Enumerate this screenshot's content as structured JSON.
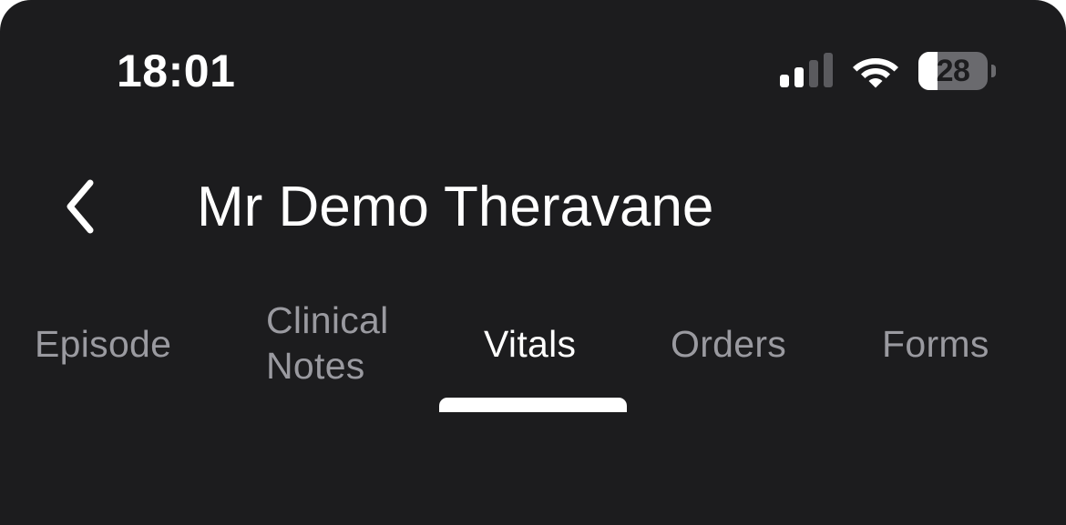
{
  "status_bar": {
    "time": "18:01",
    "signal_bars_active": 2,
    "signal_bars_total": 4,
    "wifi_icon": "wifi-icon",
    "battery_level_text": "28",
    "battery_fraction": 0.28
  },
  "header": {
    "back_icon": "chevron-left-icon",
    "title": "Mr Demo Theravane"
  },
  "tabs": [
    {
      "label": "Episode",
      "active": false
    },
    {
      "label_line1": "Clinical",
      "label_line2": "Notes",
      "active": false
    },
    {
      "label": "Vitals",
      "active": true
    },
    {
      "label": "Orders",
      "active": false
    },
    {
      "label": "Forms",
      "active": false
    }
  ],
  "colors": {
    "background": "#1c1c1e",
    "text_primary": "#ffffff",
    "text_inactive": "#9a9aa0",
    "signal_inactive": "#5a5a5e",
    "battery_empty": "#6a6a6e"
  }
}
